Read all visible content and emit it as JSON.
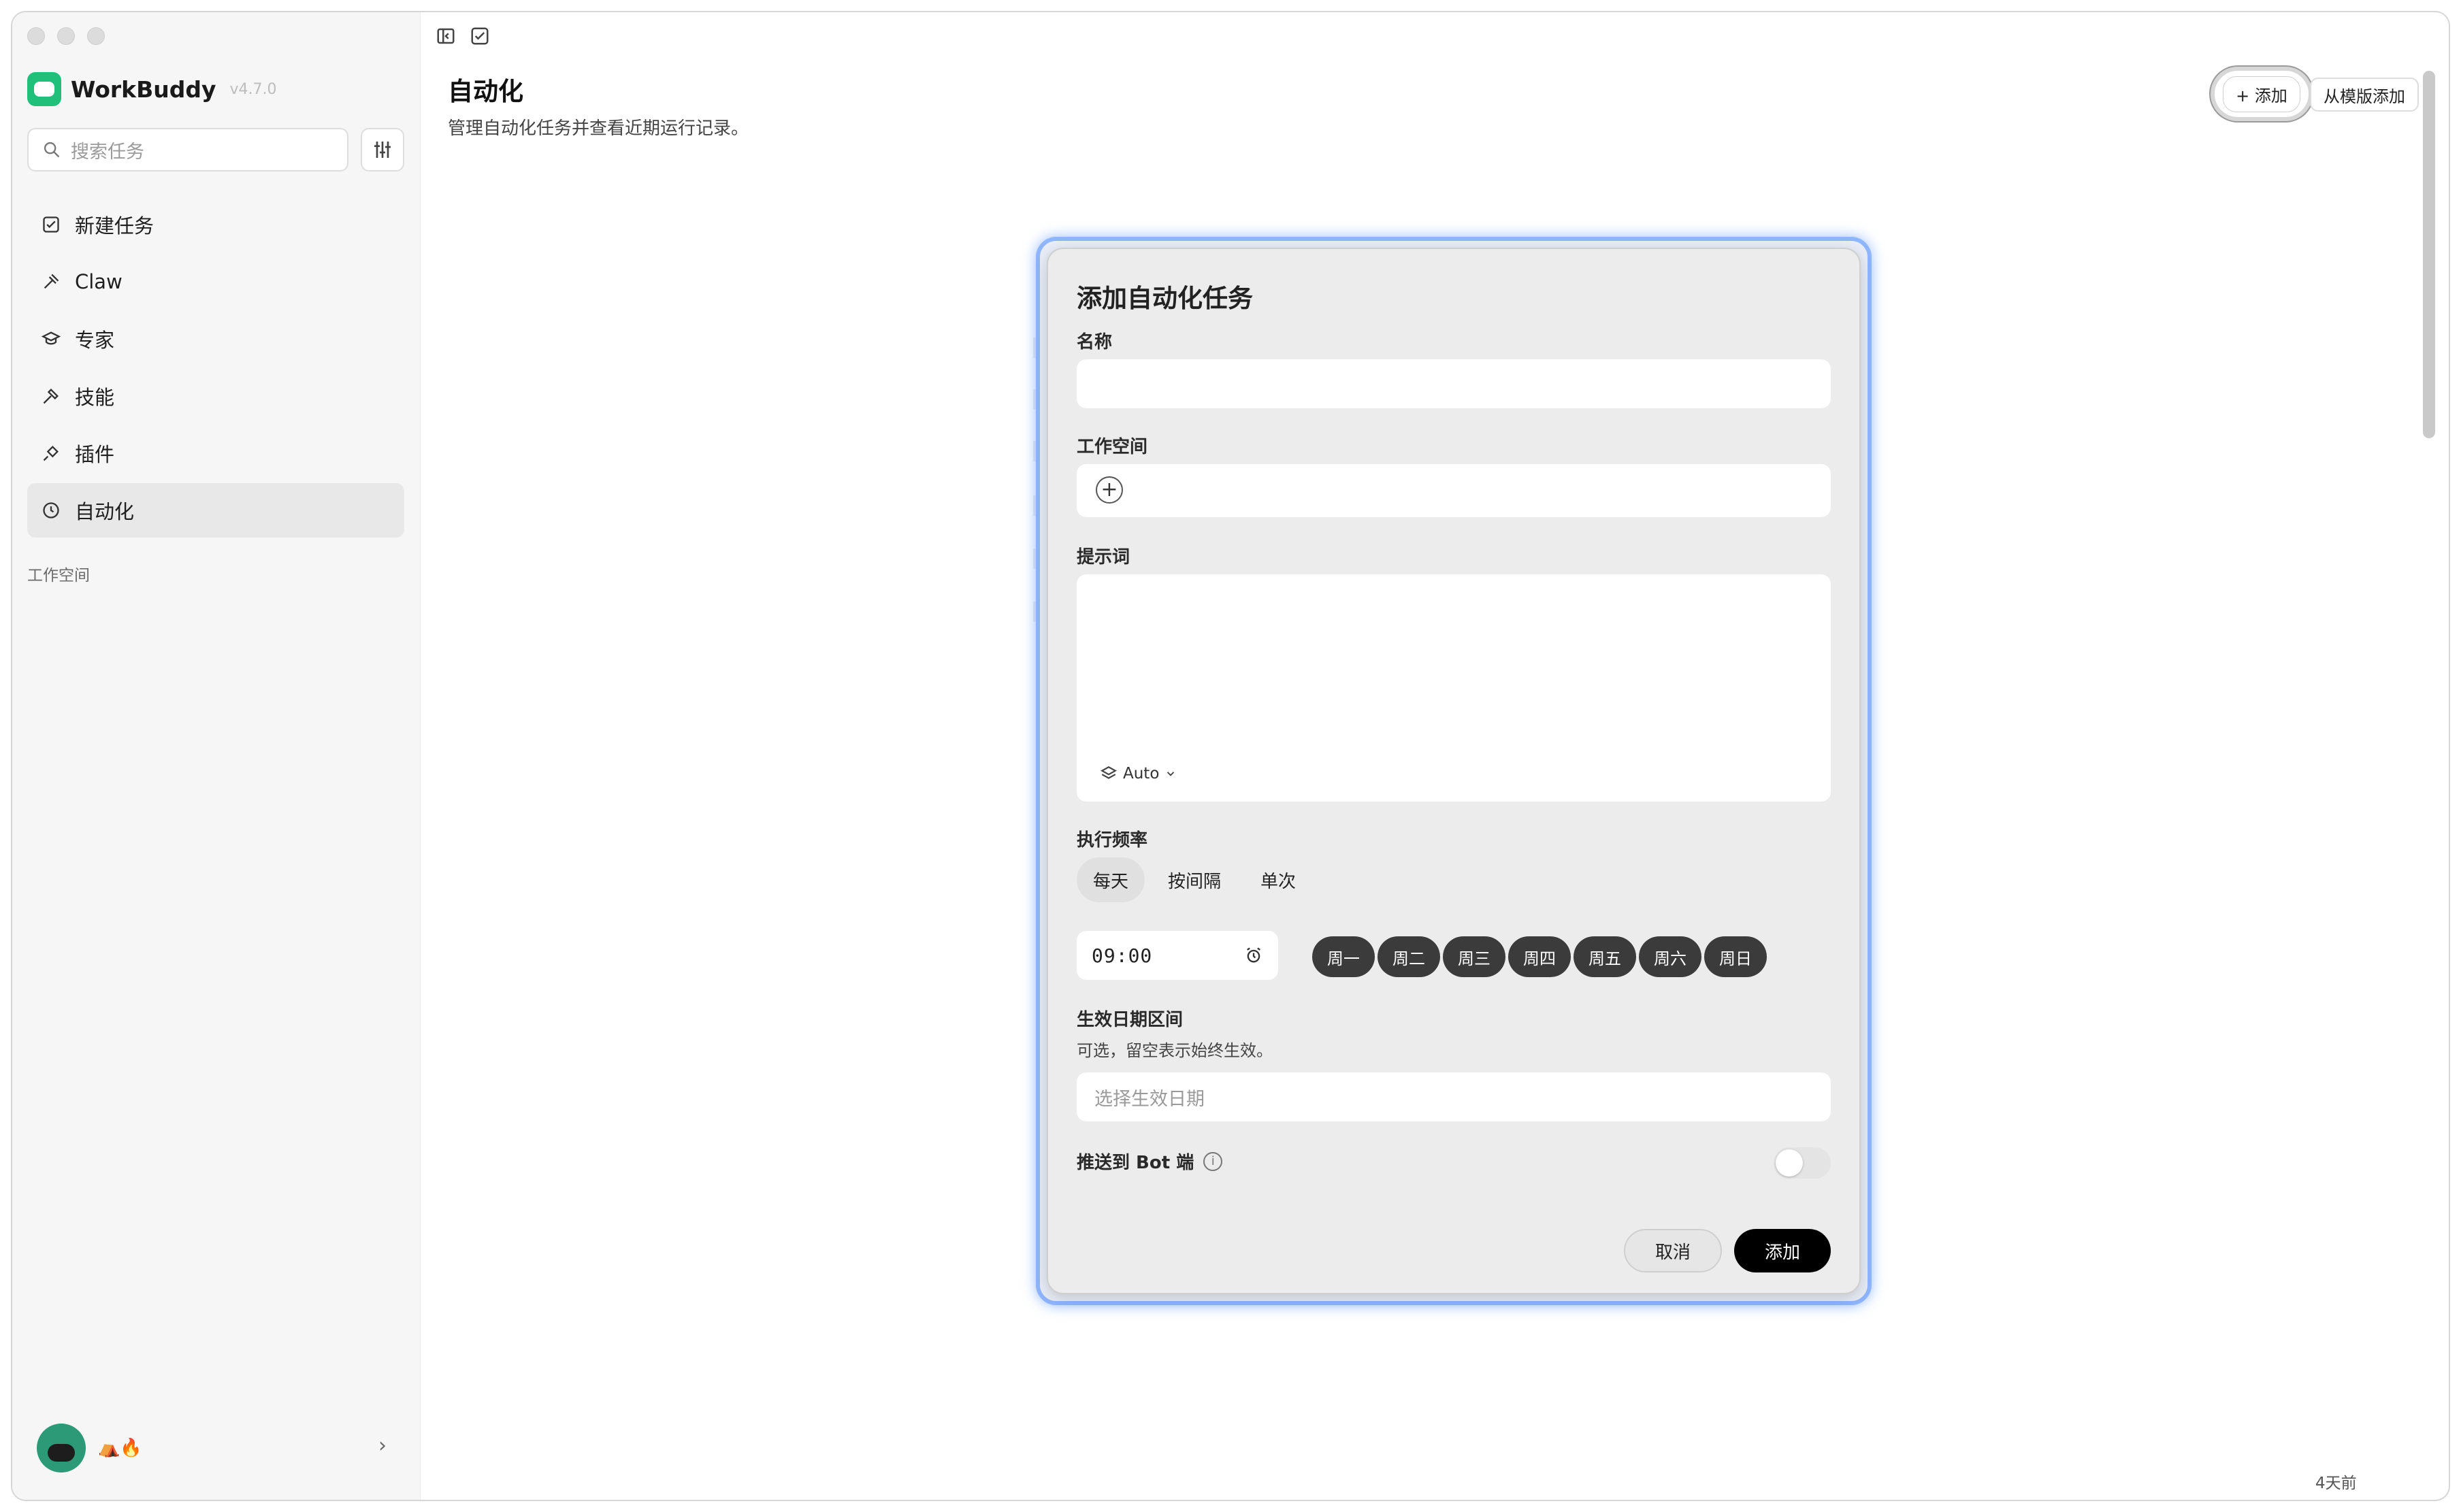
{
  "app": {
    "name": "WorkBuddy",
    "version": "v4.7.0"
  },
  "sidebar": {
    "search_placeholder": "搜索任务",
    "items": [
      {
        "label": "新建任务",
        "icon": "new-task-icon"
      },
      {
        "label": "Claw",
        "icon": "claw-icon"
      },
      {
        "label": "专家",
        "icon": "expert-icon"
      },
      {
        "label": "技能",
        "icon": "skill-icon"
      },
      {
        "label": "插件",
        "icon": "plugin-icon"
      },
      {
        "label": "自动化",
        "icon": "clock-icon",
        "active": true
      }
    ],
    "workspace_label": "工作空间",
    "user_emoji": "⛺🔥"
  },
  "main": {
    "title": "自动化",
    "subtitle": "管理自动化任务并查看近期运行记录。",
    "add_button": "+ 添加",
    "template_button": "从模版添加",
    "bottom_time": "4天前"
  },
  "dialog": {
    "title": "添加自动化任务",
    "name_label": "名称",
    "workspace_label": "工作空间",
    "prompt_label": "提示词",
    "model_label": "Auto",
    "frequency_label": "执行频率",
    "frequency_tabs": [
      "每天",
      "按间隔",
      "单次"
    ],
    "active_frequency": "每天",
    "time_value": "09:00",
    "days": [
      "周一",
      "周二",
      "周三",
      "周四",
      "周五",
      "周六",
      "周日"
    ],
    "date_range_label": "生效日期区间",
    "date_range_hint": "可选，留空表示始终生效。",
    "date_placeholder": "选择生效日期",
    "bot_push_label": "推送到 Bot 端",
    "bot_push_enabled": false,
    "cancel": "取消",
    "submit": "添加"
  }
}
